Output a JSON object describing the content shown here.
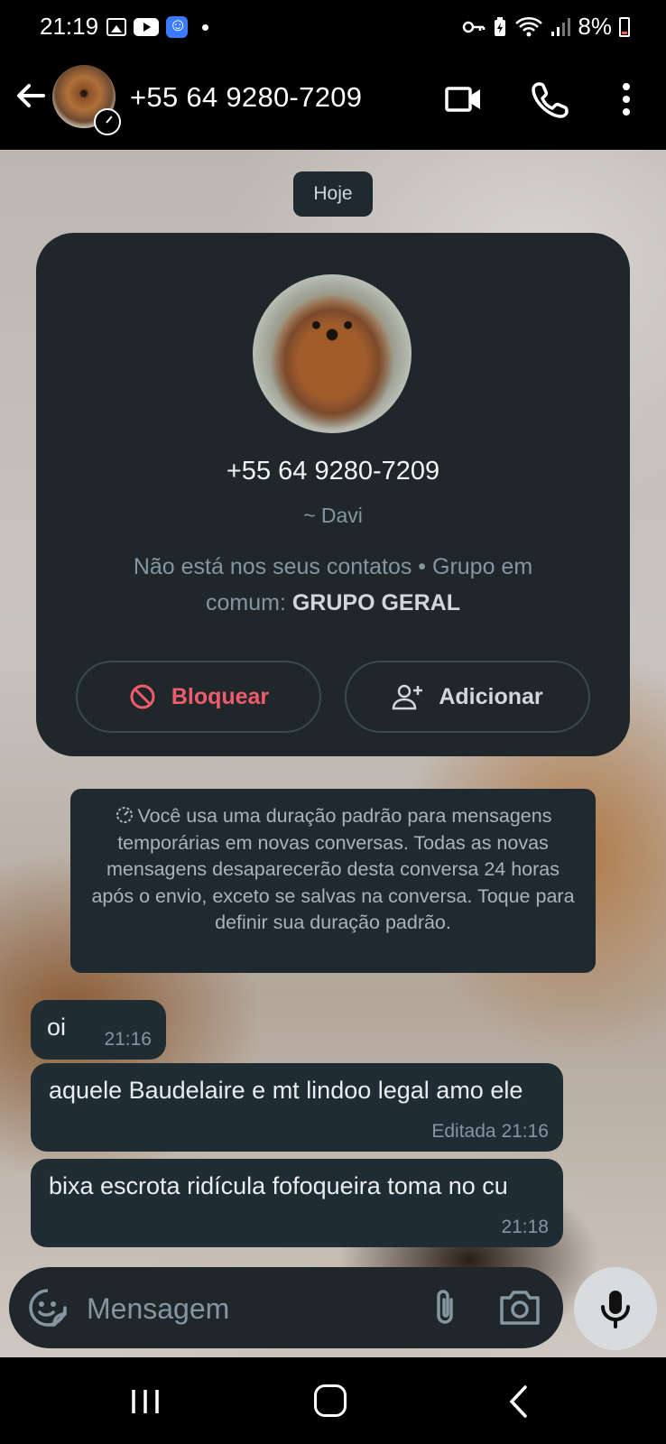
{
  "status_bar": {
    "time": "21:19",
    "icons": [
      "gallery-icon",
      "youtube-icon",
      "face-app-icon",
      "dot-icon",
      "key-icon",
      "battery-saver-icon",
      "wifi-icon",
      "signal-icon",
      "battery-icon"
    ],
    "battery": "8%"
  },
  "header": {
    "back_icon": "arrow-left-icon",
    "title": "+55 64 9280-7209",
    "actions": [
      "video-call-icon",
      "phone-call-icon",
      "more-vertical-icon"
    ]
  },
  "chat": {
    "date_divider": "Hoje",
    "contact_card": {
      "phone": "+55 64 9280-7209",
      "name": "~ Davi",
      "info_prefix": "Não está nos seus contatos • Grupo em comum: ",
      "group_name": "GRUPO GERAL",
      "block_label": "Bloquear",
      "add_label": "Adicionar"
    },
    "system_note": "Você usa uma duração padrão para mensagens temporárias em novas conversas. Todas as novas mensagens desaparecerão desta conversa 24 horas após o envio, exceto se salvas na conversa. Toque para definir sua duração padrão.",
    "messages": [
      {
        "text": "oi",
        "time": "21:16",
        "edited": ""
      },
      {
        "text": "aquele Baudelaire e mt lindoo legal amo ele",
        "time": "21:16",
        "edited": "Editada"
      },
      {
        "text": "bixa escrota ridícula fofoqueira toma no cu",
        "time": "21:18",
        "edited": ""
      }
    ]
  },
  "composer": {
    "placeholder": "Mensagem",
    "icons": [
      "sticker-icon",
      "paperclip-icon",
      "camera-icon",
      "microphone-icon"
    ]
  },
  "colors": {
    "background": "#000000",
    "card": "#1f272b",
    "bubble": "#1f2c33",
    "danger": "#f15c6d",
    "muted_text": "#8696a0"
  }
}
